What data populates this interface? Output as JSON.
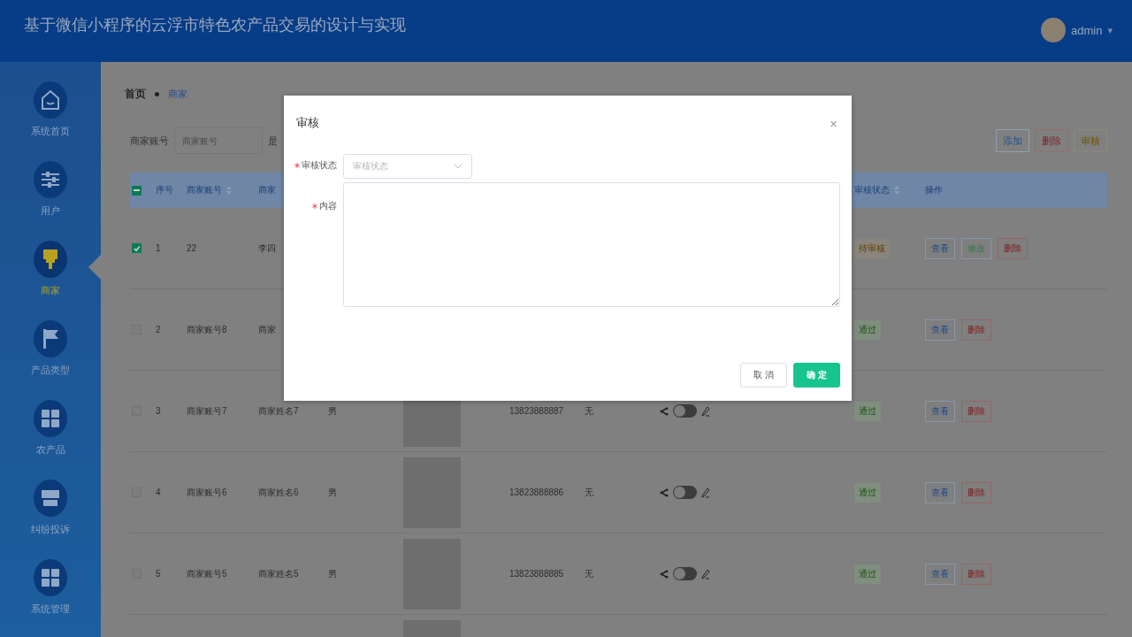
{
  "header": {
    "title": "基于微信小程序的云浮市特色农产品交易的设计与实现",
    "user": "admin",
    "caret": "▾"
  },
  "sidebar": {
    "items": [
      {
        "label": "系统首页",
        "kind": "home",
        "selected": false
      },
      {
        "label": "用户",
        "kind": "sliders",
        "selected": false
      },
      {
        "label": "商家",
        "kind": "brush",
        "selected": true
      },
      {
        "label": "产品类型",
        "kind": "flag",
        "selected": false
      },
      {
        "label": "农产品",
        "kind": "grid",
        "selected": false
      },
      {
        "label": "纠纷投诉",
        "kind": "shop",
        "selected": false
      },
      {
        "label": "系统管理",
        "kind": "grid",
        "selected": false
      }
    ]
  },
  "breadcrumb": [
    {
      "label": "首页",
      "current": false
    },
    {
      "label": "商家",
      "current": true
    }
  ],
  "search": {
    "label": "商家账号",
    "placeholder": "商家账号",
    "label_2": "是"
  },
  "toolbar": [
    {
      "label": "添加",
      "kind": "add"
    },
    {
      "label": "删除",
      "kind": "delete"
    },
    {
      "label": "审核",
      "kind": "audit"
    }
  ],
  "table": {
    "select_all": {
      "indeterminate": true
    },
    "columns": [
      {
        "label": "序号",
        "sortable": false
      },
      {
        "label": "商家账号",
        "sortable": true
      },
      {
        "label": "商家",
        "sortable": false
      },
      {
        "label": "审核状态",
        "sortable": true
      },
      {
        "label": "操作",
        "sortable": false
      }
    ],
    "rows": [
      {
        "checked": true,
        "index": "1",
        "account": "22",
        "name": "李四",
        "status": {
          "label": "待审核",
          "kind": "pending"
        },
        "actions": [
          {
            "label": "查看",
            "kind": "view"
          },
          {
            "label": "修改",
            "kind": "edit"
          },
          {
            "label": "删除",
            "kind": "delete"
          }
        ]
      },
      {
        "checked": false,
        "index": "2",
        "account": "商家账号8",
        "name": "商家",
        "status": {
          "label": "通过",
          "kind": "approved"
        },
        "actions": [
          {
            "label": "查看",
            "kind": "view"
          },
          {
            "label": "删除",
            "kind": "delete"
          }
        ]
      },
      {
        "checked": false,
        "index": "3",
        "account": "商家账号7",
        "name": "商家姓名7",
        "gender": "男",
        "has_photo": true,
        "phone": "13823888887",
        "remark": "无",
        "switch": {
          "on": false
        },
        "status": {
          "label": "通过",
          "kind": "approved"
        },
        "actions": [
          {
            "label": "查看",
            "kind": "view"
          },
          {
            "label": "删除",
            "kind": "delete"
          }
        ]
      },
      {
        "checked": false,
        "index": "4",
        "account": "商家账号6",
        "name": "商家姓名6",
        "gender": "男",
        "has_photo": true,
        "phone": "13823888886",
        "remark": "无",
        "switch": {
          "on": false
        },
        "status": {
          "label": "通过",
          "kind": "approved"
        },
        "actions": [
          {
            "label": "查看",
            "kind": "view"
          },
          {
            "label": "删除",
            "kind": "delete"
          }
        ]
      },
      {
        "checked": false,
        "index": "5",
        "account": "商家账号5",
        "name": "商家姓名5",
        "gender": "男",
        "has_photo": true,
        "phone": "13823888885",
        "remark": "无",
        "switch": {
          "on": false
        },
        "status": {
          "label": "通过",
          "kind": "approved"
        },
        "actions": [
          {
            "label": "查看",
            "kind": "view"
          },
          {
            "label": "删除",
            "kind": "delete"
          }
        ]
      },
      {
        "has_photo": true
      }
    ]
  },
  "modal": {
    "title": "审核",
    "close": "×",
    "fields": [
      {
        "label": "审核状态",
        "required": true,
        "kind": "select",
        "placeholder": "审核状态"
      },
      {
        "label": "内容",
        "required": true,
        "kind": "textarea"
      }
    ],
    "buttons": [
      {
        "label": "取 消",
        "kind": "cancel"
      },
      {
        "label": "确 定",
        "kind": "primary"
      }
    ]
  }
}
